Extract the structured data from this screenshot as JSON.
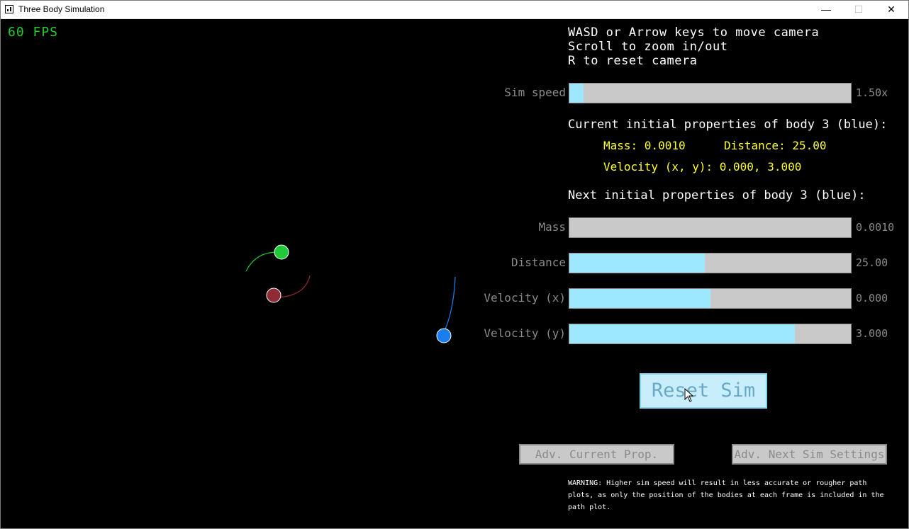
{
  "window": {
    "title": "Three Body Simulation",
    "controls": {
      "minimize": "—",
      "maximize": "☐",
      "close": "✕"
    }
  },
  "hud": {
    "fps": "60 FPS"
  },
  "instructions": [
    "WASD or Arrow keys to move camera",
    "Scroll to zoom in/out",
    "R to reset camera"
  ],
  "sim_speed": {
    "label": "Sim speed",
    "value": "1.50x",
    "level": 0.05
  },
  "current": {
    "heading": "Current initial properties of body 3 (blue):",
    "mass": "Mass: 0.0010",
    "distance": "Distance: 25.00",
    "velocity": "Velocity (x, y): 0.000, 3.000"
  },
  "next": {
    "heading": "Next initial properties of body 3 (blue):",
    "sliders": [
      {
        "label": "Mass",
        "value": "0.0010",
        "level": 0.0
      },
      {
        "label": "Distance",
        "value": "25.00",
        "level": 0.48
      },
      {
        "label": "Velocity (x)",
        "value": "0.000",
        "level": 0.5
      },
      {
        "label": "Velocity (y)",
        "value": "3.000",
        "level": 0.8
      }
    ]
  },
  "buttons": {
    "reset": "Reset Sim",
    "adv_current": "Adv. Current Prop.",
    "adv_next": "Adv. Next Sim Settings"
  },
  "warning": "WARNING: Higher sim speed will result in less accurate or rougher path plots, as only the position of the bodies at each frame is included in the path plot.",
  "colors": {
    "fps": "#29c82d",
    "highlight": "#ffff2a",
    "slider_fill": "#9de8ff",
    "body_green": "#21c83a",
    "body_red": "#8e2b35",
    "body_blue": "#1a7ef0"
  }
}
